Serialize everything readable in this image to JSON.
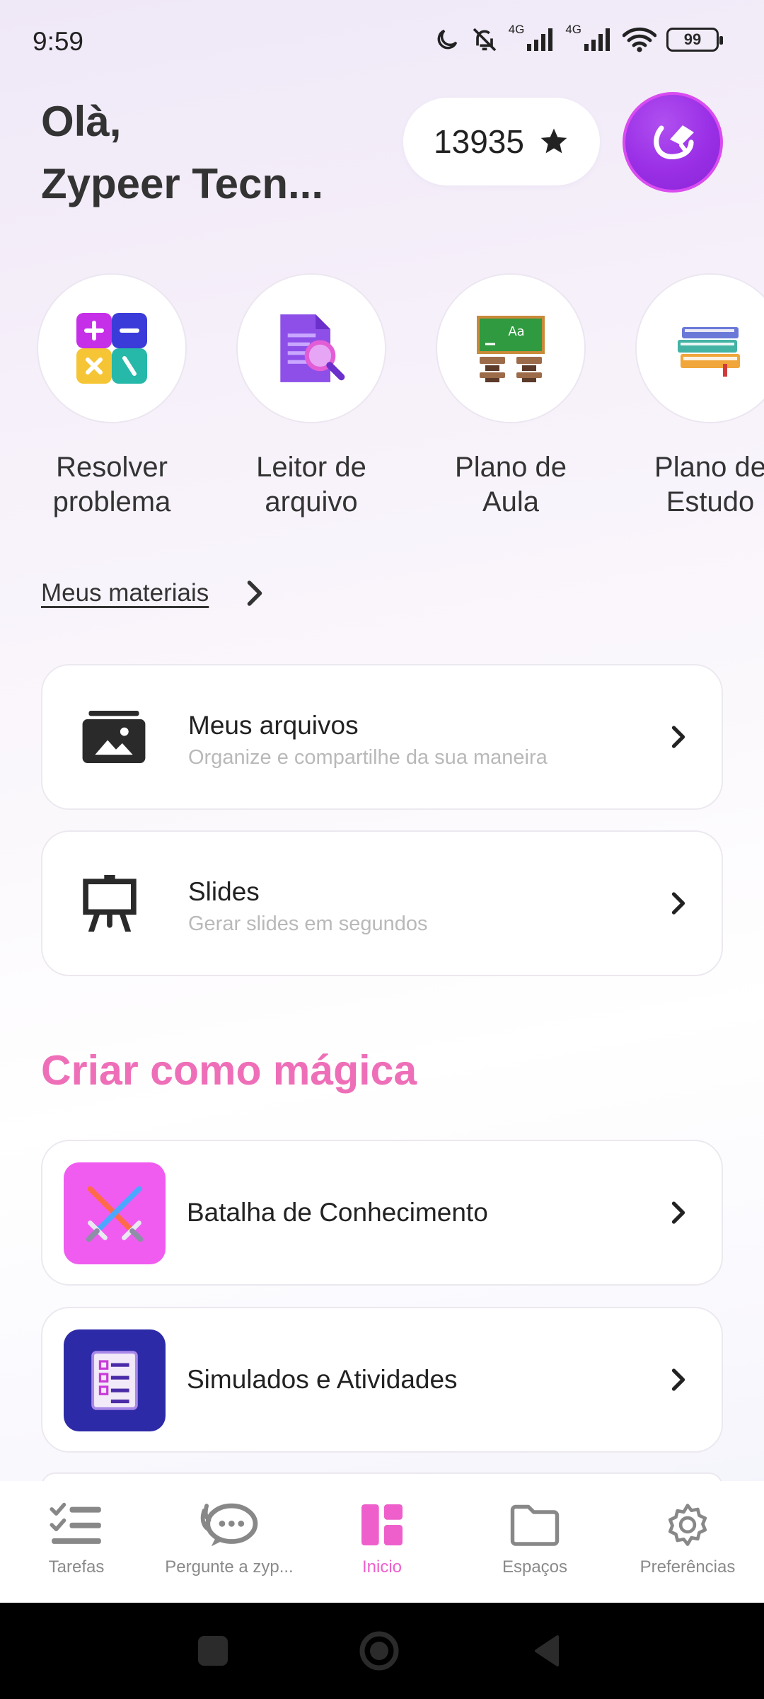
{
  "status_bar": {
    "time": "9:59",
    "network_1": "4G",
    "network_2": "4G",
    "battery": "99"
  },
  "header": {
    "greeting_line1": "Olà,",
    "greeting_line2": "Zypeer Tecn...",
    "points": "13935",
    "points_icon": "star-icon",
    "avatar_icon": "graduation-logo-icon"
  },
  "tools": [
    {
      "label_line1": "Resolver",
      "label_line2": "problema",
      "icon": "calculator-icon"
    },
    {
      "label_line1": "Leitor de",
      "label_line2": "arquivo",
      "icon": "document-search-icon"
    },
    {
      "label_line1": "Plano de",
      "label_line2": "Aula",
      "icon": "classroom-icon"
    },
    {
      "label_line1": "Plano de",
      "label_line2": "Estudo",
      "icon": "books-icon"
    }
  ],
  "materials": {
    "link_label": "Meus materiais"
  },
  "material_cards": [
    {
      "title": "Meus arquivos",
      "subtitle": "Organize e compartilhe da sua maneira",
      "icon": "folder-image-icon"
    },
    {
      "title": "Slides",
      "subtitle": "Gerar slides em segundos",
      "icon": "easel-icon"
    }
  ],
  "magic": {
    "section_title": "Criar como mágica",
    "cards": [
      {
        "title": "Batalha de Conhecimento",
        "icon": "crossed-swords-icon",
        "tile_color": "#f05cf0"
      },
      {
        "title": "Simulados e Atividades",
        "icon": "checklist-icon",
        "tile_color": "#2d2aa8"
      }
    ]
  },
  "bottom_nav": {
    "items": [
      {
        "label": "Tarefas",
        "icon": "task-list-icon",
        "active": false
      },
      {
        "label": "Pergunte a zyp...",
        "icon": "chat-bubble-icon",
        "active": false
      },
      {
        "label": "Inicio",
        "icon": "dashboard-icon",
        "active": true
      },
      {
        "label": "Espaços",
        "icon": "folder-icon",
        "active": false
      },
      {
        "label": "Preferências",
        "icon": "gear-icon",
        "active": false
      }
    ]
  },
  "colors": {
    "accent_pink": "#ee5fcb",
    "section_title": "#ee6fb8",
    "avatar_purple": "#9a2fe6"
  }
}
